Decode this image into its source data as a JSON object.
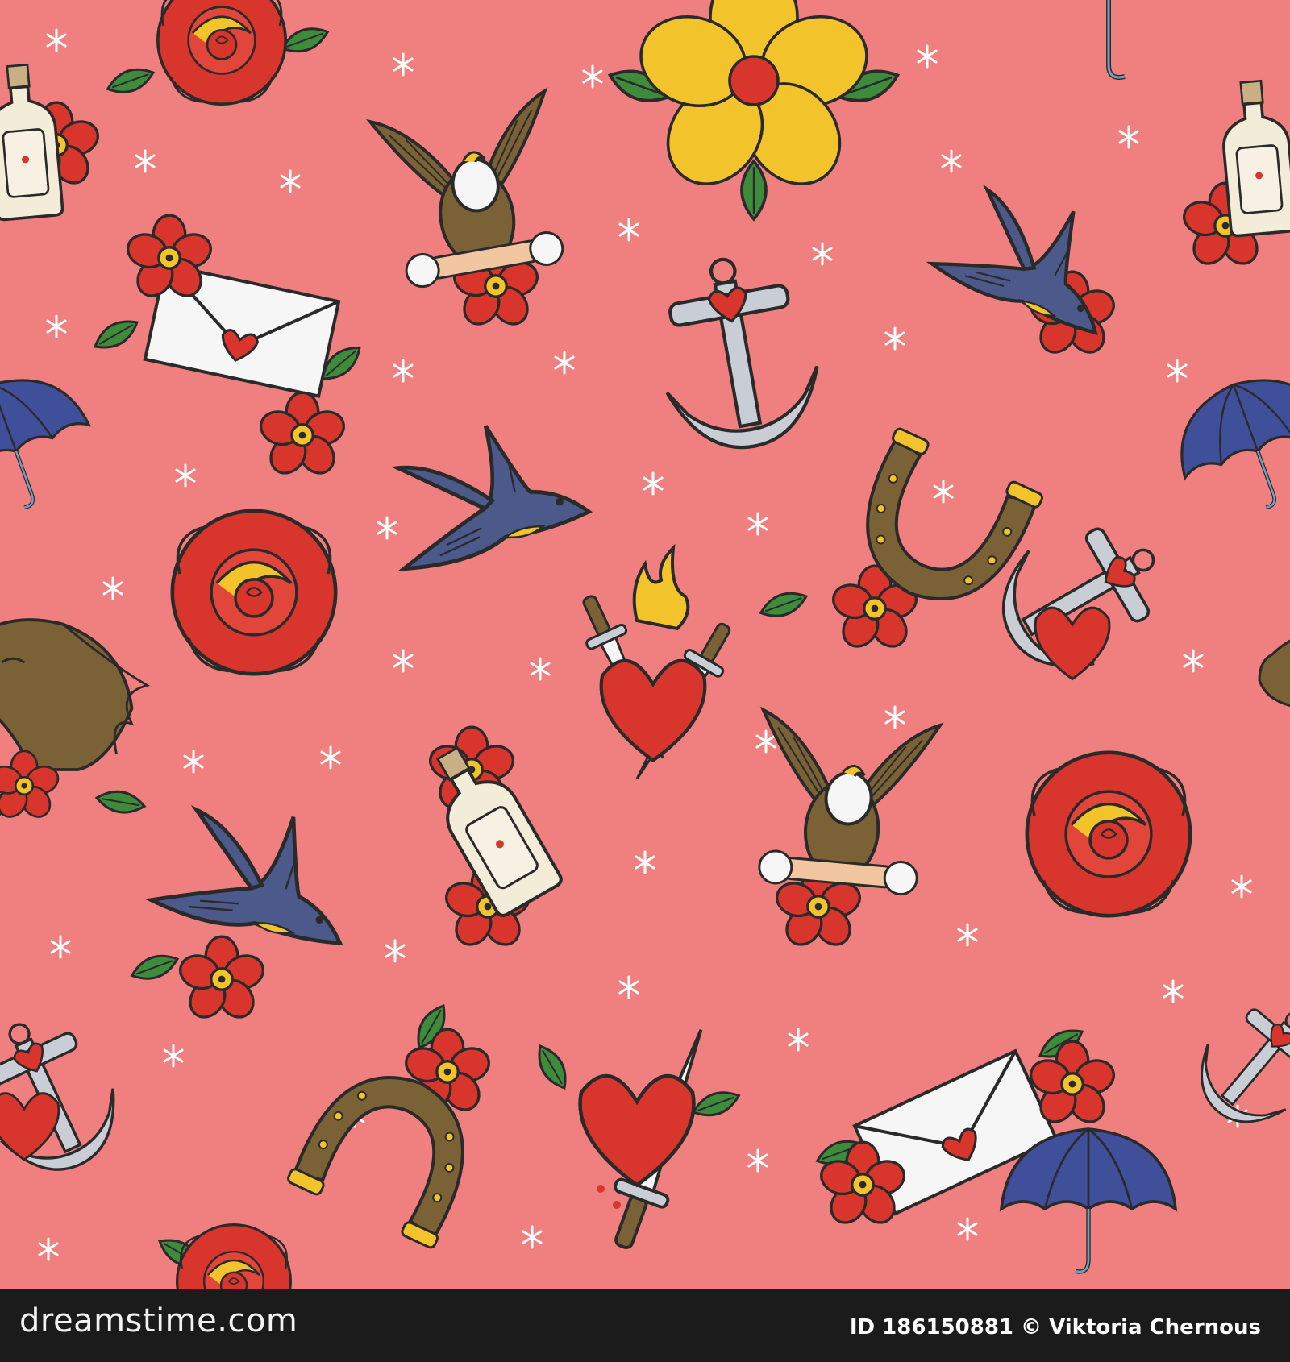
{
  "background_color": "#f08080",
  "palette": {
    "outline": "#2a2a2a",
    "red": "#d8362c",
    "yellow": "#f3c32b",
    "green": "#3e8b3c",
    "navy": "#4b5a8a",
    "brown": "#7b6236",
    "blue": "#3f4f9a",
    "white": "#f6f6f6",
    "gray": "#c9cdd6",
    "star": "#ffffff"
  },
  "motifs": [
    "rose",
    "flower",
    "eagle",
    "swallow",
    "anchor",
    "horseshoe",
    "envelope",
    "flaming-heart-daggers",
    "heart-dagger",
    "bottle-message",
    "umbrella",
    "horse-head"
  ],
  "watermark": "dreamstime",
  "footer": {
    "brand": "dreamstime.com",
    "credit": "ID 186150881 © Viktoria Chernous"
  }
}
